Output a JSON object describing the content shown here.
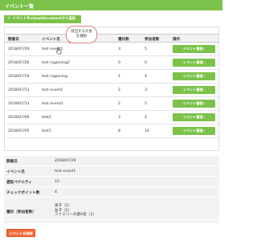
{
  "header": {
    "title": "イベント一覧"
  },
  "toolbar": {
    "import_label": "イベントをvisualdocumentから追加",
    "import_icon": "plus-icon"
  },
  "table": {
    "columns": [
      "開催日",
      "イベント名",
      "種目数",
      "参加者数",
      "操作"
    ],
    "rows": [
      {
        "date": "2018/07/29",
        "name": "test event1",
        "events": "3",
        "participants": "5",
        "action": "イベント管理"
      },
      {
        "date": "2018/07/26",
        "name": "test rogaining2",
        "events": "0",
        "participants": "0",
        "action": "イベント管理"
      },
      {
        "date": "2018/07/19",
        "name": "test rogaining",
        "events": "1",
        "participants": "4",
        "action": "イベント管理"
      },
      {
        "date": "2018/07/13",
        "name": "test event2",
        "events": "2",
        "participants": "3",
        "action": "イベント管理"
      },
      {
        "date": "2018/07/13",
        "name": "test event3",
        "events": "2",
        "participants": "5",
        "action": "イベント管理"
      },
      {
        "date": "2018/07/06",
        "name": "test2",
        "events": "3",
        "participants": "4",
        "action": "イベント管理"
      },
      {
        "date": "2018/07/05",
        "name": "test1",
        "events": "8",
        "participants": "16",
        "action": "イベント管理"
      }
    ]
  },
  "callout": {
    "line1": "該当する大会",
    "line2": "を選択"
  },
  "detail": {
    "rows": [
      {
        "label": "開催日",
        "value": "2018/07/29"
      },
      {
        "label": "イベント名",
        "value": "test event1"
      },
      {
        "label": "遅延ペナルティ",
        "value": "10"
      },
      {
        "label": "チェックポイント数",
        "value": "4"
      }
    ],
    "category_label": "種目（参加者数）",
    "categories": [
      "男子（2）",
      "女子（2）",
      "ファミリーの部A名（1）"
    ]
  },
  "delete_label": "イベントを削除",
  "colors": {
    "accent": "#7cc24a",
    "danger": "#f06b3a"
  }
}
